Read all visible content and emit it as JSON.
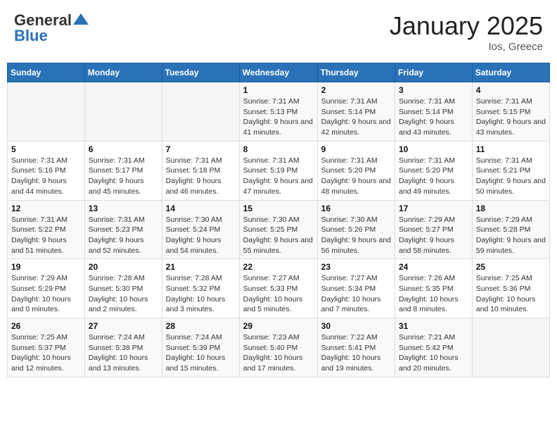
{
  "header": {
    "logo_line1": "General",
    "logo_line2": "Blue",
    "month": "January 2025",
    "location": "Ios, Greece"
  },
  "weekdays": [
    "Sunday",
    "Monday",
    "Tuesday",
    "Wednesday",
    "Thursday",
    "Friday",
    "Saturday"
  ],
  "weeks": [
    [
      {
        "day": "",
        "info": ""
      },
      {
        "day": "",
        "info": ""
      },
      {
        "day": "",
        "info": ""
      },
      {
        "day": "1",
        "info": "Sunrise: 7:31 AM\nSunset: 5:13 PM\nDaylight: 9 hours and 41 minutes."
      },
      {
        "day": "2",
        "info": "Sunrise: 7:31 AM\nSunset: 5:14 PM\nDaylight: 9 hours and 42 minutes."
      },
      {
        "day": "3",
        "info": "Sunrise: 7:31 AM\nSunset: 5:14 PM\nDaylight: 9 hours and 43 minutes."
      },
      {
        "day": "4",
        "info": "Sunrise: 7:31 AM\nSunset: 5:15 PM\nDaylight: 9 hours and 43 minutes."
      }
    ],
    [
      {
        "day": "5",
        "info": "Sunrise: 7:31 AM\nSunset: 5:16 PM\nDaylight: 9 hours and 44 minutes."
      },
      {
        "day": "6",
        "info": "Sunrise: 7:31 AM\nSunset: 5:17 PM\nDaylight: 9 hours and 45 minutes."
      },
      {
        "day": "7",
        "info": "Sunrise: 7:31 AM\nSunset: 5:18 PM\nDaylight: 9 hours and 46 minutes."
      },
      {
        "day": "8",
        "info": "Sunrise: 7:31 AM\nSunset: 5:19 PM\nDaylight: 9 hours and 47 minutes."
      },
      {
        "day": "9",
        "info": "Sunrise: 7:31 AM\nSunset: 5:20 PM\nDaylight: 9 hours and 48 minutes."
      },
      {
        "day": "10",
        "info": "Sunrise: 7:31 AM\nSunset: 5:20 PM\nDaylight: 9 hours and 49 minutes."
      },
      {
        "day": "11",
        "info": "Sunrise: 7:31 AM\nSunset: 5:21 PM\nDaylight: 9 hours and 50 minutes."
      }
    ],
    [
      {
        "day": "12",
        "info": "Sunrise: 7:31 AM\nSunset: 5:22 PM\nDaylight: 9 hours and 51 minutes."
      },
      {
        "day": "13",
        "info": "Sunrise: 7:31 AM\nSunset: 5:23 PM\nDaylight: 9 hours and 52 minutes."
      },
      {
        "day": "14",
        "info": "Sunrise: 7:30 AM\nSunset: 5:24 PM\nDaylight: 9 hours and 54 minutes."
      },
      {
        "day": "15",
        "info": "Sunrise: 7:30 AM\nSunset: 5:25 PM\nDaylight: 9 hours and 55 minutes."
      },
      {
        "day": "16",
        "info": "Sunrise: 7:30 AM\nSunset: 5:26 PM\nDaylight: 9 hours and 56 minutes."
      },
      {
        "day": "17",
        "info": "Sunrise: 7:29 AM\nSunset: 5:27 PM\nDaylight: 9 hours and 58 minutes."
      },
      {
        "day": "18",
        "info": "Sunrise: 7:29 AM\nSunset: 5:28 PM\nDaylight: 9 hours and 59 minutes."
      }
    ],
    [
      {
        "day": "19",
        "info": "Sunrise: 7:29 AM\nSunset: 5:29 PM\nDaylight: 10 hours and 0 minutes."
      },
      {
        "day": "20",
        "info": "Sunrise: 7:28 AM\nSunset: 5:30 PM\nDaylight: 10 hours and 2 minutes."
      },
      {
        "day": "21",
        "info": "Sunrise: 7:28 AM\nSunset: 5:32 PM\nDaylight: 10 hours and 3 minutes."
      },
      {
        "day": "22",
        "info": "Sunrise: 7:27 AM\nSunset: 5:33 PM\nDaylight: 10 hours and 5 minutes."
      },
      {
        "day": "23",
        "info": "Sunrise: 7:27 AM\nSunset: 5:34 PM\nDaylight: 10 hours and 7 minutes."
      },
      {
        "day": "24",
        "info": "Sunrise: 7:26 AM\nSunset: 5:35 PM\nDaylight: 10 hours and 8 minutes."
      },
      {
        "day": "25",
        "info": "Sunrise: 7:25 AM\nSunset: 5:36 PM\nDaylight: 10 hours and 10 minutes."
      }
    ],
    [
      {
        "day": "26",
        "info": "Sunrise: 7:25 AM\nSunset: 5:37 PM\nDaylight: 10 hours and 12 minutes."
      },
      {
        "day": "27",
        "info": "Sunrise: 7:24 AM\nSunset: 5:38 PM\nDaylight: 10 hours and 13 minutes."
      },
      {
        "day": "28",
        "info": "Sunrise: 7:24 AM\nSunset: 5:39 PM\nDaylight: 10 hours and 15 minutes."
      },
      {
        "day": "29",
        "info": "Sunrise: 7:23 AM\nSunset: 5:40 PM\nDaylight: 10 hours and 17 minutes."
      },
      {
        "day": "30",
        "info": "Sunrise: 7:22 AM\nSunset: 5:41 PM\nDaylight: 10 hours and 19 minutes."
      },
      {
        "day": "31",
        "info": "Sunrise: 7:21 AM\nSunset: 5:42 PM\nDaylight: 10 hours and 20 minutes."
      },
      {
        "day": "",
        "info": ""
      }
    ]
  ]
}
